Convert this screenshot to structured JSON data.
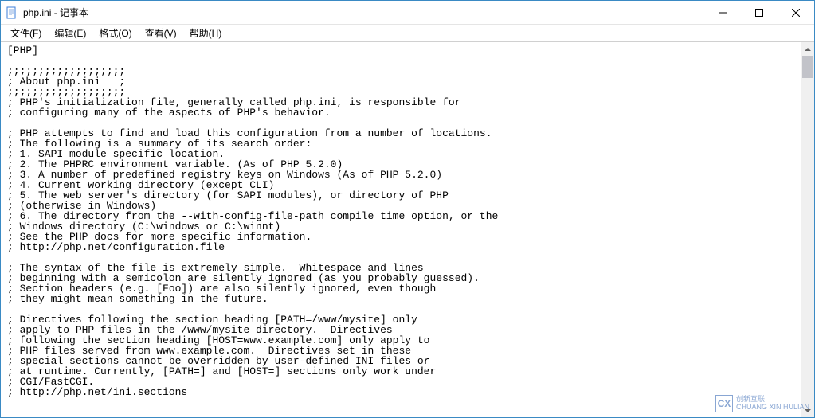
{
  "window": {
    "title": "php.ini - 记事本",
    "app_name": "记事本"
  },
  "menu": {
    "file": "文件(F)",
    "edit": "编辑(E)",
    "format": "格式(O)",
    "view": "查看(V)",
    "help": "帮助(H)"
  },
  "content_lines": [
    "[PHP]",
    "",
    ";;;;;;;;;;;;;;;;;;;",
    "; About php.ini   ;",
    ";;;;;;;;;;;;;;;;;;;",
    "; PHP's initialization file, generally called php.ini, is responsible for",
    "; configuring many of the aspects of PHP's behavior.",
    "",
    "; PHP attempts to find and load this configuration from a number of locations.",
    "; The following is a summary of its search order:",
    "; 1. SAPI module specific location.",
    "; 2. The PHPRC environment variable. (As of PHP 5.2.0)",
    "; 3. A number of predefined registry keys on Windows (As of PHP 5.2.0)",
    "; 4. Current working directory (except CLI)",
    "; 5. The web server's directory (for SAPI modules), or directory of PHP",
    "; (otherwise in Windows)",
    "; 6. The directory from the --with-config-file-path compile time option, or the",
    "; Windows directory (C:\\windows or C:\\winnt)",
    "; See the PHP docs for more specific information.",
    "; http://php.net/configuration.file",
    "",
    "; The syntax of the file is extremely simple.  Whitespace and lines",
    "; beginning with a semicolon are silently ignored (as you probably guessed).",
    "; Section headers (e.g. [Foo]) are also silently ignored, even though",
    "; they might mean something in the future.",
    "",
    "; Directives following the section heading [PATH=/www/mysite] only",
    "; apply to PHP files in the /www/mysite directory.  Directives",
    "; following the section heading [HOST=www.example.com] only apply to",
    "; PHP files served from www.example.com.  Directives set in these",
    "; special sections cannot be overridden by user-defined INI files or",
    "; at runtime. Currently, [PATH=] and [HOST=] sections only work under",
    "; CGI/FastCGI.",
    "; http://php.net/ini.sections"
  ],
  "watermark": {
    "brand_zh": "创新互联",
    "brand_en": "CHUANG XIN HULIAN",
    "mark": "CX"
  }
}
